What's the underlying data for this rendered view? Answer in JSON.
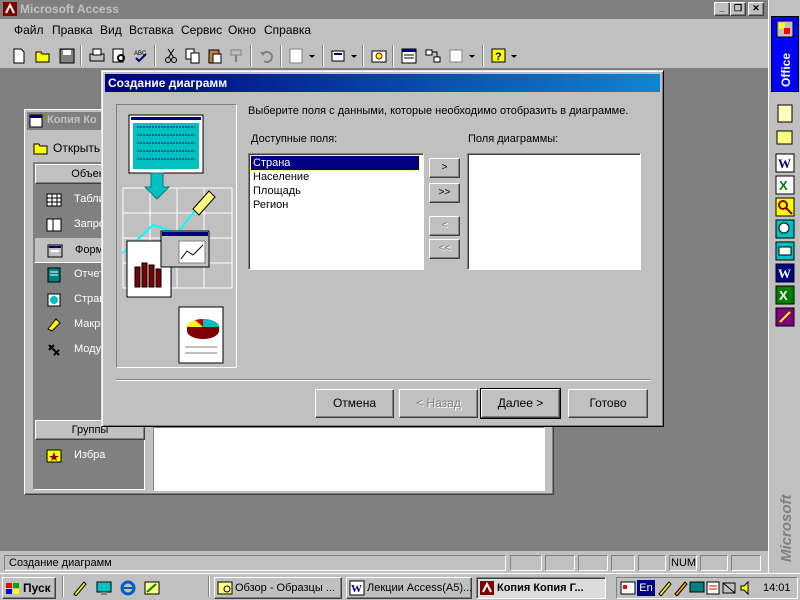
{
  "app": {
    "title": "Microsoft Access"
  },
  "menu": {
    "file": "Файл",
    "edit": "Правка",
    "view": "Вид",
    "insert": "Вставка",
    "tools": "Сервис",
    "window": "Окно",
    "help": "Справка"
  },
  "db_window": {
    "title": "Копия Ко",
    "open_label": "Открыть",
    "objects_header": "Объект",
    "groups_header": "Группы",
    "items": [
      {
        "label": "Табли",
        "icon": "table-icon"
      },
      {
        "label": "Запро",
        "icon": "query-icon"
      },
      {
        "label": "Форм",
        "icon": "form-icon"
      },
      {
        "label": "Отчет",
        "icon": "report-icon"
      },
      {
        "label": "Стран",
        "icon": "page-icon"
      },
      {
        "label": "Макро",
        "icon": "macro-icon"
      },
      {
        "label": "Моду",
        "icon": "module-icon"
      }
    ],
    "favorites": "Избра"
  },
  "dialog": {
    "title": "Создание диаграмм",
    "instruction": "Выберите поля с данными, которые необходимо отобразить в диаграмме.",
    "available_label": "Доступные поля:",
    "chart_fields_label": "Поля диаграммы:",
    "available_fields": [
      "Страна",
      "Население",
      "Площадь",
      "Регион"
    ],
    "chart_fields": [],
    "move_one": ">",
    "move_all": ">>",
    "remove_one": "<",
    "remove_all": "<<",
    "cancel": "Отмена",
    "back": "< Назад",
    "next": "Далее >",
    "finish": "Готово"
  },
  "sidebar": {
    "label": "Office",
    "brand": "Microsoft"
  },
  "status": {
    "text": "Создание диаграмм",
    "num": "NUM"
  },
  "taskbar": {
    "start": "Пуск",
    "tasks": [
      "Обзор - Образцы ...",
      "Лекции Access(A5)...",
      "Копия Копия Г..."
    ],
    "lang": "En",
    "clock": "14:01"
  },
  "colors": {
    "title_active": "#000080",
    "title_inactive": "#808080",
    "face": "#c0c0c0",
    "desktop": "#808080"
  }
}
